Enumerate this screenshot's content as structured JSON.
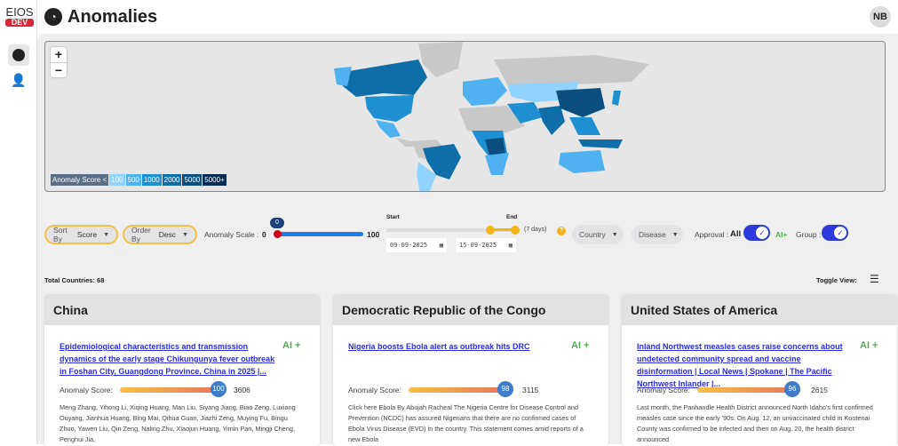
{
  "app": {
    "logo_text": "EIOS",
    "logo_badge": "DEV",
    "title": "Anomalies",
    "user_initials": "NB"
  },
  "sidebar": {
    "items": [
      {
        "name": "anomalies",
        "icon": "gauge-icon"
      },
      {
        "name": "users",
        "icon": "person-icon"
      }
    ]
  },
  "map": {
    "zoom_in": "+",
    "zoom_out": "−",
    "legend": {
      "label": "Anomaly Score <",
      "bins": [
        {
          "label": "100",
          "color": "#8fd3fe"
        },
        {
          "label": "500",
          "color": "#4fb1ef"
        },
        {
          "label": "1000",
          "color": "#1e8fd0"
        },
        {
          "label": "2000",
          "color": "#0f6ea8"
        },
        {
          "label": "5000",
          "color": "#0b4f80"
        },
        {
          "label": "5000+",
          "color": "#072d56"
        }
      ]
    }
  },
  "filters": {
    "sort_by": {
      "label": "Sort By",
      "value": "Score"
    },
    "order_by": {
      "label": "Order By",
      "value": "Desc"
    },
    "anomaly_scale": {
      "label": "Anomaly Scale :",
      "min": "0",
      "max": "100",
      "value": "0"
    },
    "dates": {
      "start_label": "Start",
      "end_label": "End",
      "start": "09-09-2025",
      "end": "15-09-2025",
      "duration": "(7 days)",
      "help": "?"
    },
    "country": "Country",
    "disease": "Disease",
    "approval": {
      "label": "Approval :",
      "value": "All",
      "ai_label": "AI+"
    },
    "group": {
      "label": "Group :"
    }
  },
  "summary": {
    "total_countries": "Total Countries: 68",
    "toggle_view": "Toggle View:"
  },
  "cards": [
    {
      "country": "China",
      "title": "Epidemiological characteristics and transmission dynamics of the early stage Chikungunya fever outbreak in Foshan City, Guangdong Province, China in 2025 |...",
      "ai": "AI +",
      "score_label": "Anomaly Score:",
      "score": "100",
      "count": "3606",
      "desc": "Meng Zhang, Yihong Li, Xiqing Huang, Man Liu, Siyang Jiang, Biao Zeng, Luxiang Ouyang, Jianhua Huang, Bing Mai, Qihua Guan, Jiazhi Zeng, Muying Fu, Bingu Zhuo, Yawen Liu, Qin Zeng, Naling Zhu, Xiaojun Huang, Yimin Pan, Mingji Cheng, Penghui Jia,"
    },
    {
      "country": "Democratic Republic of the Congo",
      "title": "Nigeria boosts Ebola alert as outbreak hits DRC",
      "ai": "AI +",
      "score_label": "Anomaly Score:",
      "score": "98",
      "count": "3115",
      "desc": "Click here Ebola By Abujah Racheal The Nigeria Centre for Disease Control and Prevention (NCDC) has assured Nigerians that there are no confirmed cases of Ebola Virus Disease (EVD) in the country. This statement comes amid reports of a new Ebola"
    },
    {
      "country": "United States of America",
      "title": "Inland Northwest measles cases raise concerns about undetected community spread and vaccine disinformation | Local News | Spokane | The Pacific Northwest Inlander |...",
      "ai": "AI +",
      "score_label": "Anomaly Score:",
      "score": "96",
      "count": "2615",
      "desc": "Last month, the Panhandle Health District announced North Idaho's first confirmed measles case since the early '90s. On Aug. 12, an unvaccinated child in Kootenai County was confirmed to be infected and then on Aug. 20, the health district announced"
    }
  ]
}
